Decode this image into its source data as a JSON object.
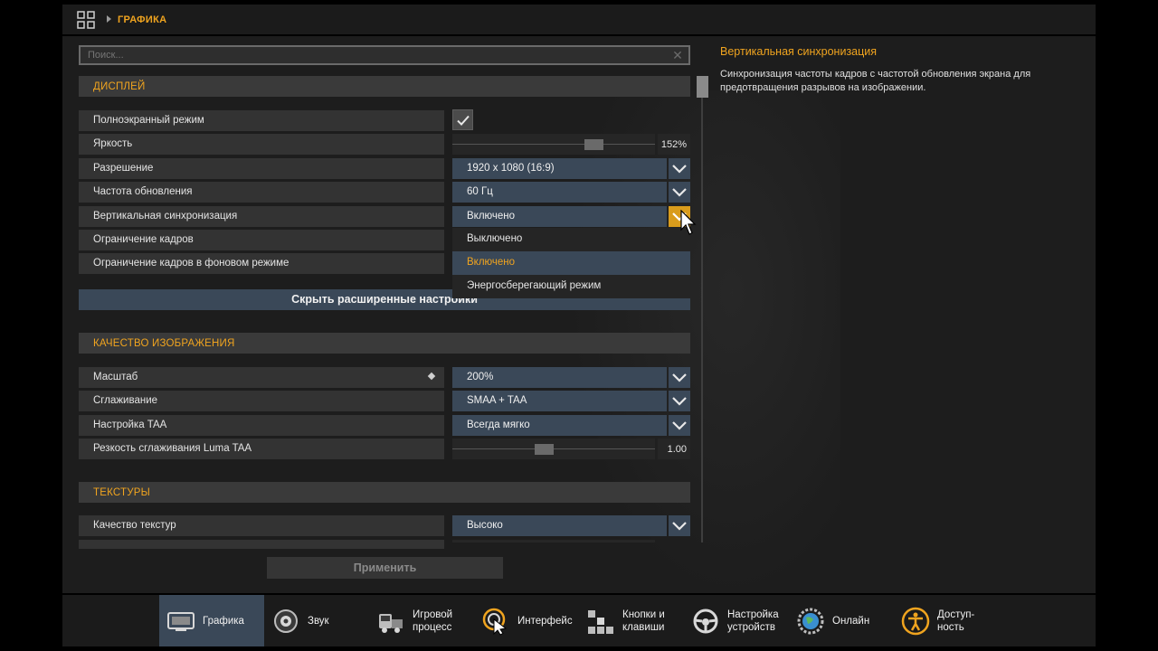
{
  "breadcrumb": {
    "current": "ГРАФИКА"
  },
  "search": {
    "placeholder": "Поиск..."
  },
  "sections": {
    "display": "ДИСПЛЕЙ",
    "image_quality": "КАЧЕСТВО ИЗОБРАЖЕНИЯ",
    "textures": "ТЕКСТУРЫ"
  },
  "display_rows": {
    "fullscreen": {
      "label": "Полноэкранный режим",
      "checked": true
    },
    "brightness": {
      "label": "Яркость",
      "value": "152%",
      "fraction": 0.72
    },
    "resolution": {
      "label": "Разрешение",
      "value": "1920 x 1080 (16:9)"
    },
    "refresh": {
      "label": "Частота обновления",
      "value": "60 Гц"
    },
    "vsync": {
      "label": "Вертикальная синхронизация",
      "value": "Включено"
    },
    "frame_limit": {
      "label": "Ограничение кадров"
    },
    "bg_frame_limit": {
      "label": "Ограничение кадров в фоновом режиме"
    }
  },
  "vsync_dropdown": {
    "options": [
      "Выключено",
      "Включено",
      "Энергосберегающий режим"
    ],
    "selected_index": 1
  },
  "hide_advanced": "Скрыть расширенные настройки",
  "quality_rows": {
    "scale": {
      "label": "Масштаб",
      "value": "200%"
    },
    "antialias": {
      "label": "Сглаживание",
      "value": "SMAA + TAA"
    },
    "taa": {
      "label": "Настройка TAA",
      "value": "Всегда мягко"
    },
    "luma": {
      "label": "Резкость сглаживания Luma TAA",
      "value": "1.00",
      "fraction": 0.45
    }
  },
  "texture_rows": {
    "quality": {
      "label": "Качество текстур",
      "value": "Высоко"
    }
  },
  "apply": "Применить",
  "info": {
    "title": "Вертикальная синхронизация",
    "text": "Синхронизация частоты кадров с частотой обновления экрана для предотвращения разрывов на изображении."
  },
  "nav": {
    "graphics": "Графика",
    "sound": "Звук",
    "gameplay": "Игровой\nпроцесс",
    "interface": "Интерфейс",
    "keys": "Кнопки и\nклавиши",
    "devices": "Настройка\nустройств",
    "online": "Онлайн",
    "accessibility": "Доступ-\nность"
  },
  "colors": {
    "accent": "#f0a41f",
    "select_bg": "#3a4858",
    "row_bg": "#333333",
    "panel_bg": "#1d1d1d"
  }
}
